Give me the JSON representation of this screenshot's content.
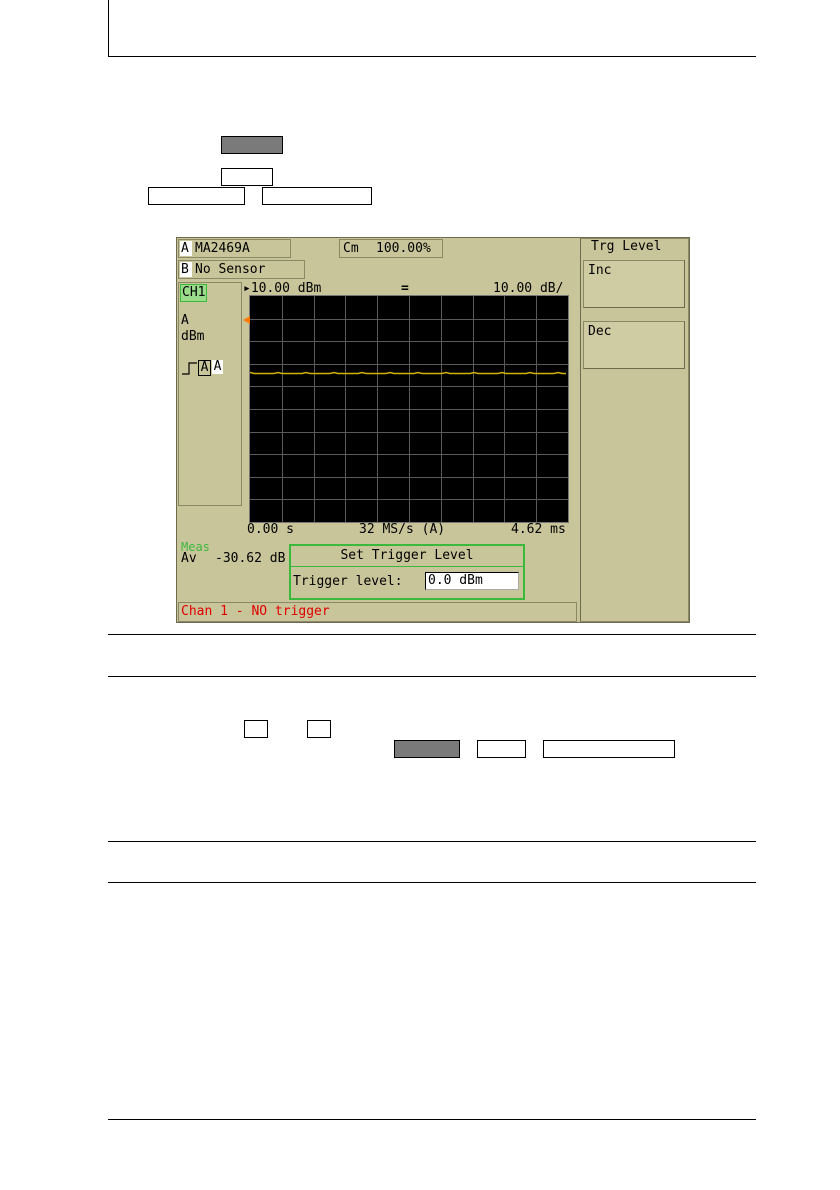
{
  "document": {
    "key_row1": "",
    "key_row2": "",
    "key_row3a": "",
    "key_row3b": "",
    "key_inline1": "",
    "key_inline2": "",
    "key_inline3": "",
    "key_inline4": "",
    "key_inline5": ""
  },
  "screen": {
    "sensor_a_letter": "A",
    "sensor_a_model": "MA2469A",
    "cal_factor_label": "Cm",
    "cal_factor_value": "100.00%",
    "sensor_b_letter": "B",
    "sensor_b_status": "No Sensor",
    "channel_label": "CH1",
    "sensor_label": "A",
    "unit_label": "dBm",
    "trigger_source_a1": "A",
    "trigger_source_a2": "A",
    "ref_level": "▸10.00 dBm",
    "coupling_symbol": "=",
    "scale": "10.00 dB/",
    "time_start": "0.00 s",
    "sample_rate": "32 MS/s (A)",
    "time_end": "4.62 ms",
    "meas_label": "Meas",
    "meas_type": "Av",
    "meas_value": "-30.62 dB",
    "status_message": "Chan 1 - NO trigger",
    "status_color": "#e00000",
    "trace_color": "#d2b400",
    "trigger_marker_color": "#ff7a00",
    "dialog_border_color": "#3cb93c"
  },
  "menu": {
    "title": "Trg Level",
    "inc_label": "Inc",
    "dec_label": "Dec"
  },
  "dialog": {
    "title": "Set Trigger Level",
    "field_label": "Trigger level:",
    "field_value": "0.0 dBm"
  }
}
